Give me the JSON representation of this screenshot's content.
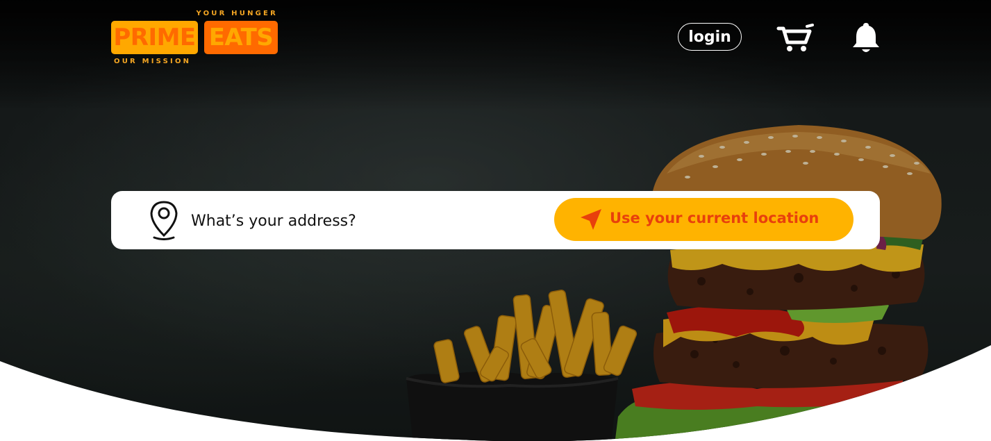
{
  "brand": {
    "tagline_top": "YOUR HUNGER",
    "name_part1": "PRIME",
    "name_part2": "EATS",
    "tagline_bottom": "OUR MISSION"
  },
  "header": {
    "login_label": "login",
    "cart_icon": "cart-icon",
    "bell_icon": "bell-icon"
  },
  "search": {
    "pin_icon": "location-pin-icon",
    "placeholder": "What’s your address?",
    "location_button_label": "Use your current location",
    "location_button_icon": "navigation-arrow-icon"
  },
  "colors": {
    "accent_yellow": "#ffb300",
    "accent_orange": "#ff6a00",
    "button_text": "#e8400c"
  }
}
